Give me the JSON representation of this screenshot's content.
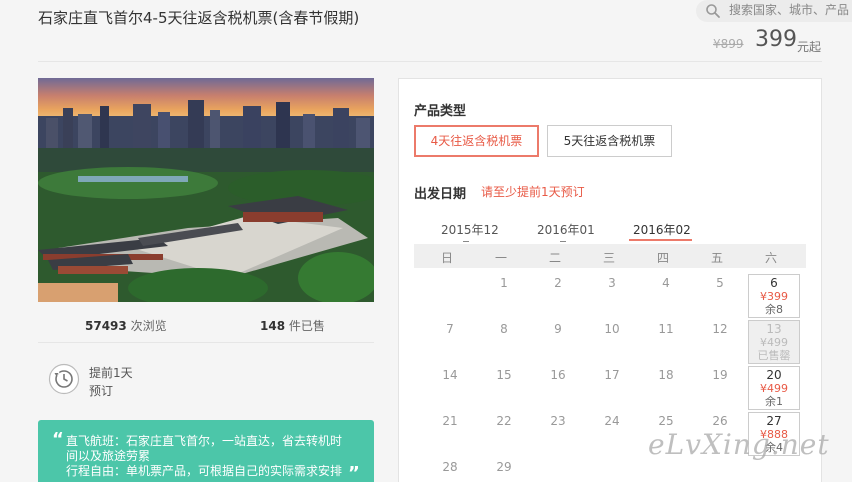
{
  "product": {
    "title": "石家庄直飞首尔4-5天往返含税机票(含春节假期)",
    "original_price": "¥899",
    "price": "399",
    "price_unit": "元起"
  },
  "search": {
    "placeholder": "搜索国家、城市、产品"
  },
  "stats": {
    "views": "57493",
    "views_label": "次浏览",
    "sold": "148",
    "sold_label": "件已售"
  },
  "advance": {
    "line1": "提前1天",
    "line2": "预订"
  },
  "description": {
    "line1": "直飞航班：石家庄直飞首尔，一站直达，省去转机时",
    "line2": "间以及旅途劳累",
    "line3": "行程自由：单机票产品，可根据自己的实际需求安排"
  },
  "booking": {
    "product_type_label": "产品类型",
    "types": [
      "4天往返含税机票",
      "5天往返含税机票"
    ],
    "date_label": "出发日期",
    "date_hint": "请至少提前1天预订",
    "months": [
      "2015年12",
      "2016年01",
      "2016年02"
    ],
    "weekdays": [
      "日",
      "一",
      "二",
      "三",
      "四",
      "五",
      "六"
    ],
    "days": {
      "row1": [
        "1",
        "2",
        "3",
        "4",
        "5"
      ],
      "row2": [
        "7",
        "8",
        "9",
        "10",
        "11",
        "12"
      ],
      "row3": [
        "14",
        "15",
        "16",
        "17",
        "18",
        "19"
      ],
      "row4": [
        "21",
        "22",
        "23",
        "24",
        "25",
        "26"
      ],
      "row5": [
        "28",
        "29"
      ]
    },
    "saturdays": [
      {
        "day": "6",
        "price": "¥399",
        "status": "余8"
      },
      {
        "day": "13",
        "price": "¥499",
        "status": "已售罄"
      },
      {
        "day": "20",
        "price": "¥499",
        "status": "余1"
      },
      {
        "day": "27",
        "price": "¥888",
        "status": "余4"
      }
    ]
  },
  "watermark": "eLvXing.net",
  "colors": {
    "accent": "#e85a46",
    "teal": "#4cc6a9"
  }
}
